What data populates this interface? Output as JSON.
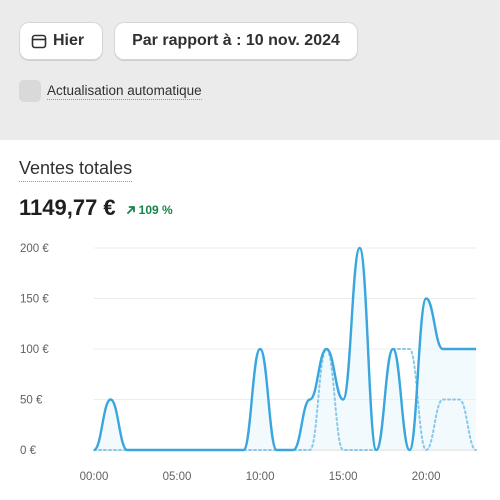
{
  "toolbar": {
    "date_label": "Hier",
    "compare_label": "Par rapport à : 10 nov. 2024",
    "auto_refresh_label": "Actualisation automatique",
    "auto_refresh_checked": false
  },
  "card": {
    "title": "Ventes totales",
    "value": "1149,77 €",
    "delta": "109 %",
    "delta_direction": "up"
  },
  "colors": {
    "primary_line": "#3aa6dd",
    "comparison_line": "#88c8ea",
    "delta_positive": "#14854a",
    "header_bg": "#ebebeb"
  },
  "chart_data": {
    "type": "line",
    "x": [
      "00:00",
      "01:00",
      "02:00",
      "03:00",
      "04:00",
      "05:00",
      "06:00",
      "07:00",
      "08:00",
      "09:00",
      "10:00",
      "11:00",
      "12:00",
      "13:00",
      "14:00",
      "15:00",
      "16:00",
      "17:00",
      "18:00",
      "19:00",
      "20:00",
      "21:00",
      "22:00",
      "23:00"
    ],
    "x_tick_labels": [
      "00:00",
      "05:00",
      "10:00",
      "15:00",
      "20:00"
    ],
    "y_tick_labels": [
      "0 €",
      "50 €",
      "100 €",
      "150 €",
      "200 €"
    ],
    "ylim": [
      0,
      200
    ],
    "grid": true,
    "series": [
      {
        "style": "solid",
        "values": [
          0,
          50,
          0,
          0,
          0,
          0,
          0,
          0,
          0,
          0,
          100,
          0,
          0,
          50,
          100,
          50,
          200,
          0,
          100,
          0,
          150,
          100,
          100,
          100
        ]
      },
      {
        "style": "dotted",
        "values": [
          0,
          0,
          0,
          0,
          0,
          0,
          0,
          0,
          0,
          0,
          0,
          0,
          0,
          0,
          100,
          0,
          0,
          0,
          100,
          100,
          0,
          50,
          50,
          0
        ]
      }
    ]
  }
}
